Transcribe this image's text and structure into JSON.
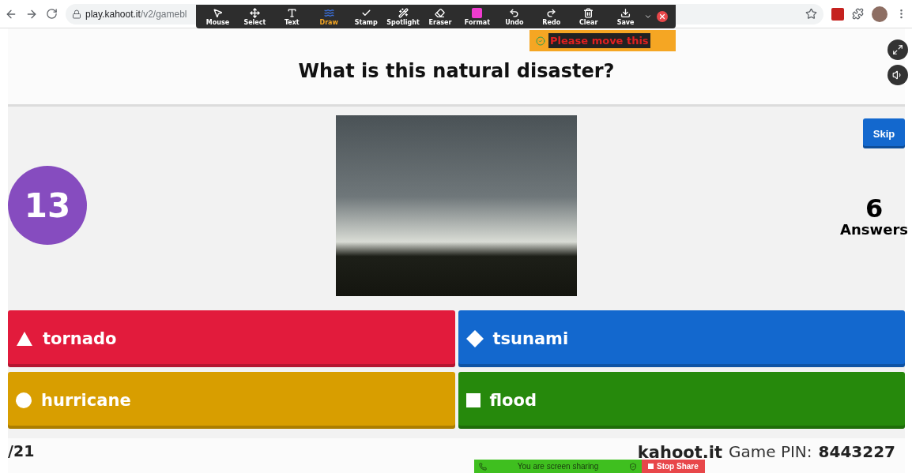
{
  "browser": {
    "url_host": "play.kahoot.it",
    "url_path": "/v2/gamebl"
  },
  "annotation_toolbar": {
    "tools": [
      {
        "kind": "mouse",
        "label": "Mouse",
        "selected": false
      },
      {
        "kind": "select",
        "label": "Select",
        "selected": false
      },
      {
        "kind": "text",
        "label": "Text",
        "selected": false
      },
      {
        "kind": "draw",
        "label": "Draw",
        "selected": true
      },
      {
        "kind": "stamp",
        "label": "Stamp",
        "selected": false
      },
      {
        "kind": "spotlight",
        "label": "Spotlight",
        "selected": false
      },
      {
        "kind": "eraser",
        "label": "Eraser",
        "selected": false
      },
      {
        "kind": "format",
        "label": "Format",
        "selected": false
      },
      {
        "kind": "undo",
        "label": "Undo",
        "selected": false
      },
      {
        "kind": "redo",
        "label": "Redo",
        "selected": false
      },
      {
        "kind": "clear",
        "label": "Clear",
        "selected": false
      },
      {
        "kind": "save",
        "label": "Save",
        "selected": false
      }
    ]
  },
  "banner": {
    "text": "Please move this"
  },
  "question": {
    "title": "What is this natural disaster?",
    "timer": "13",
    "answer_count": "6",
    "answer_label": "Answers",
    "skip": "Skip"
  },
  "answers": [
    {
      "kind": "triangle",
      "text": "tornado",
      "color": "#e21b3c"
    },
    {
      "kind": "diamond",
      "text": "tsunami",
      "color": "#1368ce"
    },
    {
      "kind": "circle",
      "text": "hurricane",
      "color": "#d89e00"
    },
    {
      "kind": "square",
      "text": "flood",
      "color": "#26890c"
    }
  ],
  "footer": {
    "progress": "/21",
    "logo": "kahoot.it",
    "pin_label": "Game PIN:",
    "pin": "8443227"
  },
  "share_bar": {
    "status": "You are screen sharing",
    "stop": "Stop Share"
  }
}
